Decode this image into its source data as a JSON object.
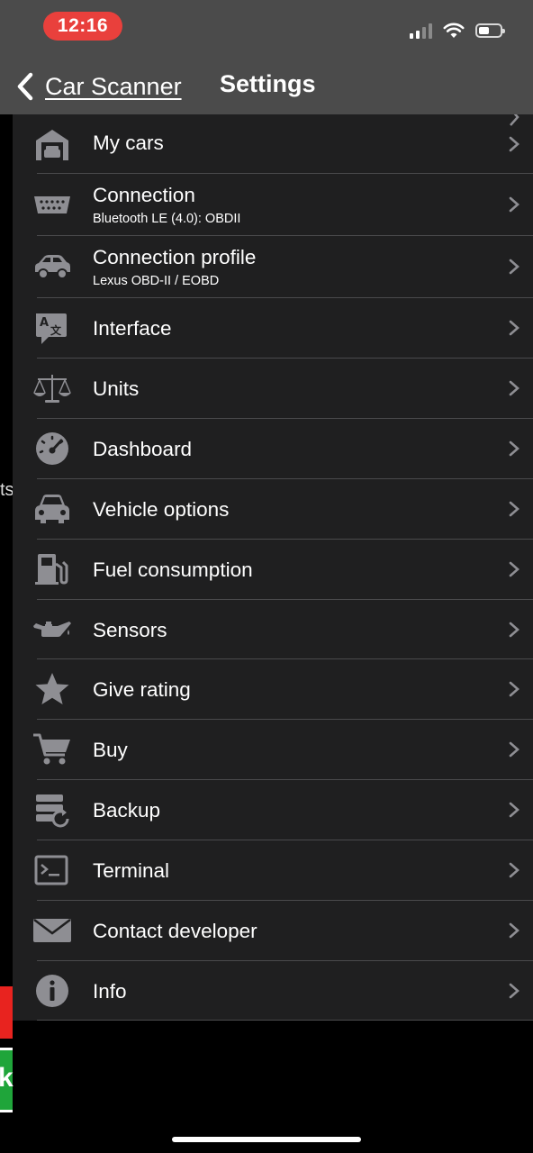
{
  "status_bar": {
    "time": "12:16"
  },
  "nav": {
    "back_label": "Car Scanner",
    "title": "Settings"
  },
  "side_peek": {
    "left_text": "ts",
    "badge_letter": "k"
  },
  "colors": {
    "accent_red": "#e9403c",
    "panel_bg": "#1f1f20",
    "header_bg": "#4b4b4b",
    "icon_gray": "#8e8e93"
  },
  "menu": [
    {
      "title": "My cars",
      "icon": "garage-icon"
    },
    {
      "title": "Connection",
      "subtitle": "Bluetooth LE (4.0): OBDII",
      "icon": "obd-connector-icon"
    },
    {
      "title": "Connection profile",
      "subtitle": "Lexus OBD-II / EOBD",
      "icon": "car-side-icon"
    },
    {
      "title": "Interface",
      "icon": "translate-icon"
    },
    {
      "title": "Units",
      "icon": "scales-icon"
    },
    {
      "title": "Dashboard",
      "icon": "gauge-icon"
    },
    {
      "title": "Vehicle options",
      "icon": "car-front-icon"
    },
    {
      "title": "Fuel consumption",
      "icon": "fuel-pump-icon"
    },
    {
      "title": "Sensors",
      "icon": "oil-can-icon"
    },
    {
      "title": "Give rating",
      "icon": "star-icon"
    },
    {
      "title": "Buy",
      "icon": "cart-icon"
    },
    {
      "title": "Backup",
      "icon": "backup-icon"
    },
    {
      "title": "Terminal",
      "icon": "terminal-icon"
    },
    {
      "title": "Contact developer",
      "icon": "envelope-icon"
    },
    {
      "title": "Info",
      "icon": "info-icon"
    }
  ]
}
